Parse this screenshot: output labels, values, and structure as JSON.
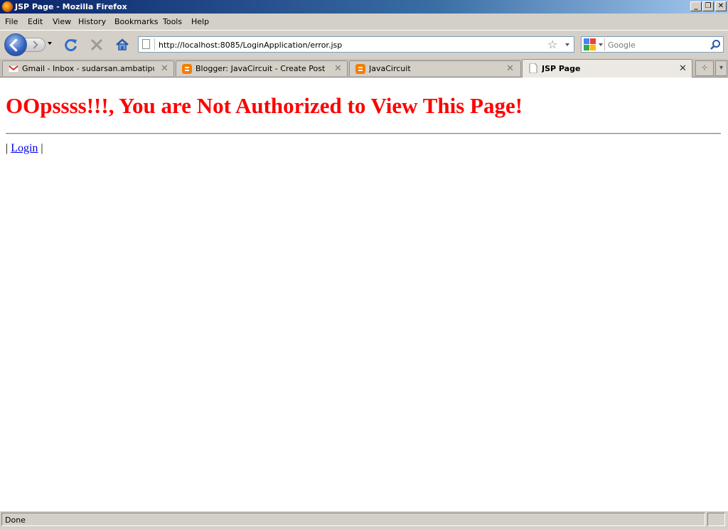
{
  "window": {
    "title": "JSP Page - Mozilla Firefox",
    "controls": {
      "minimize": "_",
      "restore": "❐",
      "close": "✕"
    }
  },
  "menu": {
    "file": "File",
    "edit": "Edit",
    "view": "View",
    "history": "History",
    "bookmarks": "Bookmarks",
    "tools": "Tools",
    "help": "Help"
  },
  "navigation": {
    "url": "http://localhost:8085/LoginApplication/error.jsp",
    "search_placeholder": "Google",
    "icons": [
      "back-icon",
      "forward-icon",
      "history-dropdown-icon",
      "reload-icon",
      "stop-icon",
      "home-icon",
      "page-icon",
      "bookmark-star-icon",
      "search-engine-icon",
      "search-go-icon"
    ]
  },
  "tabs": [
    {
      "label": "Gmail - Inbox - sudarsan.ambatipudi...",
      "icon": "gmail-icon",
      "active": false
    },
    {
      "label": "Blogger: JavaCircuit - Create Post",
      "icon": "blogger-icon",
      "active": false
    },
    {
      "label": "JavaCircuit",
      "icon": "blogger-icon",
      "active": false
    },
    {
      "label": "JSP Page",
      "icon": "page-icon",
      "active": true
    }
  ],
  "tab_close_glyph": "✕",
  "tab_controls": {
    "list_tabs": "⊹",
    "menu": "▾"
  },
  "page": {
    "heading": "OOpssss!!!, You are Not Authorized to View This Page!",
    "link_prefix": "| ",
    "login_link": "Login",
    "link_suffix": " |"
  },
  "status": {
    "text": "Done"
  },
  "colors": {
    "heading": "#ff0000",
    "link": "#0000ee",
    "titlebar_start": "#0a246a",
    "titlebar_end": "#a6caf0",
    "chrome": "#d4d0c8"
  }
}
